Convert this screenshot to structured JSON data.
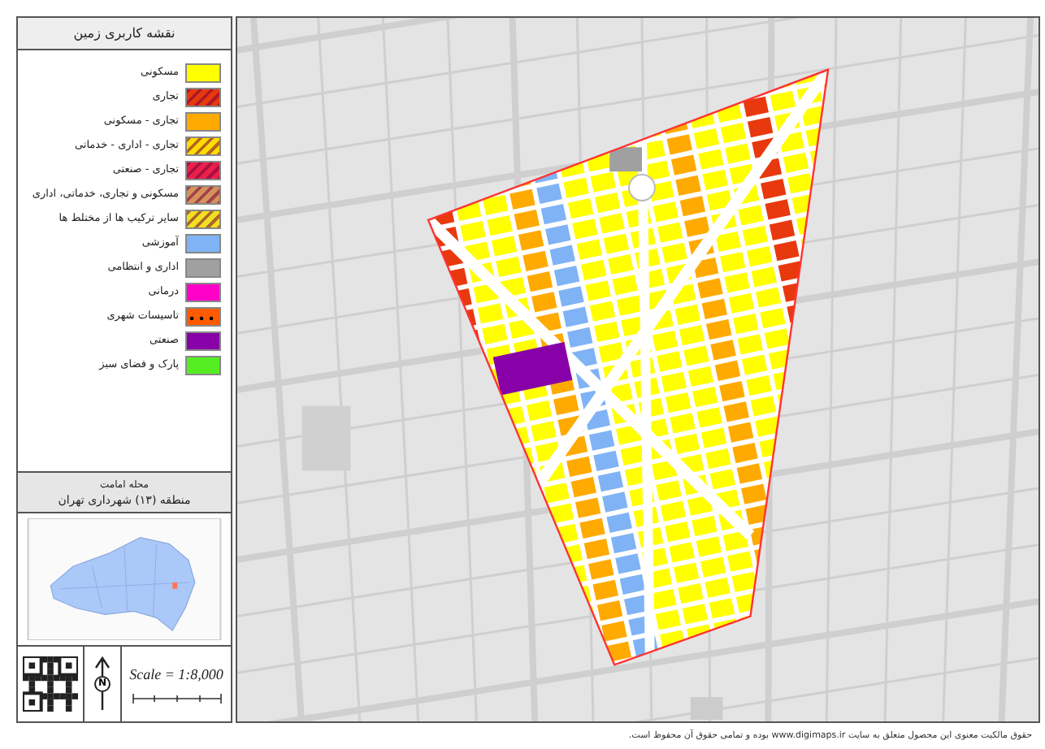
{
  "legend": {
    "title": "نقشه کاربری زمین",
    "items": [
      {
        "label": "مسکونی",
        "color": "#ffff00",
        "kind": "solid"
      },
      {
        "label": "تجاری",
        "color": "#e8380d",
        "kind": "hatched"
      },
      {
        "label": "تجاری - مسکونی",
        "color": "#ffaa00",
        "kind": "solid"
      },
      {
        "label": "تجاری - اداری - خدماتی",
        "color": "#ffdd00",
        "kind": "hatched"
      },
      {
        "label": "تجاری - صنعتی",
        "color": "#e8204a",
        "kind": "hatched"
      },
      {
        "label": "مسکونی و تجاری، خدماتی، اداری",
        "color": "#d4915a",
        "kind": "hatched"
      },
      {
        "label": "سایر ترکیب ها از مختلط ها",
        "color": "#f0e020",
        "kind": "hatched"
      },
      {
        "label": "آموزشی",
        "color": "#7fb3f5",
        "kind": "solid"
      },
      {
        "label": "اداری و انتظامی",
        "color": "#a0a0a0",
        "kind": "solid"
      },
      {
        "label": "درمانی",
        "color": "#ff00c8",
        "kind": "solid"
      },
      {
        "label": "تاسیسات شهری",
        "color": "#ff5a00",
        "kind": "dotted"
      },
      {
        "label": "صنعتی",
        "color": "#8800a8",
        "kind": "solid"
      },
      {
        "label": "پارک و فضای سبز",
        "color": "#55ee22",
        "kind": "solid"
      }
    ]
  },
  "district": {
    "name": "محله امامت",
    "region": "منطقه (۱۳) شهرداری تهران"
  },
  "north_arrow": {
    "label": "N"
  },
  "scale": {
    "text": "Scale = 1:8,000"
  },
  "footer": "حقوق مالکیت معنوی این محصول متعلق به سایت www.digimaps.ir بوده و تمامی حقوق آن محفوظ است."
}
